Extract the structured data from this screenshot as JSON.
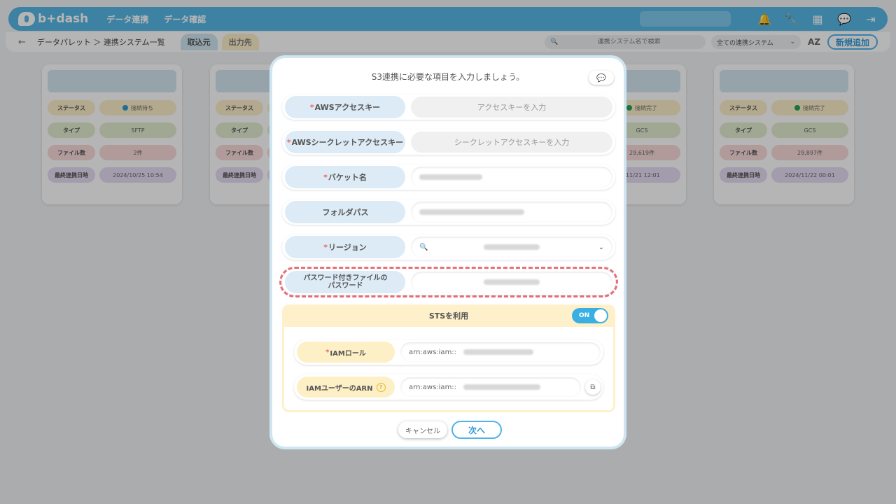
{
  "header": {
    "logo": "b+dash",
    "nav": [
      "データ連携",
      "データ確認"
    ]
  },
  "subbar": {
    "breadcrumb": "データパレット ＞ 連携システム一覧",
    "tab_in": "取込元",
    "tab_out": "出力先",
    "search_placeholder": "連携システム名で検索",
    "filter": "全ての連携システム",
    "sort": "AZ",
    "add": "新規追加"
  },
  "cards": [
    {
      "status_label": "ステータス",
      "status": "接続待ち",
      "type_label": "タイプ",
      "type": "SFTP",
      "files_label": "ファイル数",
      "files": "2件",
      "last_label": "最終連携日時",
      "last": "2024/10/25 10:54"
    },
    {
      "status_label": "ステータス",
      "type_label": "タイプ",
      "files_label": "ファイル数",
      "last_label": "最終連携日時"
    },
    {
      "status": "接続完了",
      "type": "GCS",
      "files": "29,619件",
      "last": "/11/21 12:01"
    },
    {
      "status_label": "ステータス",
      "status": "接続完了",
      "type_label": "タイプ",
      "type": "GCS",
      "files_label": "ファイル数",
      "files": "29,897件",
      "last_label": "最終連携日時",
      "last": "2024/11/22 00:01"
    }
  ],
  "modal": {
    "title": "S3連携に必要な項目を入力しましょう。",
    "fields": [
      {
        "label": "AWSアクセスキー",
        "required": "*",
        "placeholder": "アクセスキーを入力"
      },
      {
        "label": "AWSシークレットアクセスキー",
        "required": "*",
        "placeholder": "シークレットアクセスキーを入力"
      },
      {
        "label": "バケット名",
        "required": "*"
      },
      {
        "label": "フォルダパス",
        "required": ""
      },
      {
        "label": "リージョン",
        "required": "*"
      },
      {
        "label": "パスワード付きファイルの\nパスワード",
        "required": ""
      }
    ],
    "sts": {
      "label": "STSを利用",
      "toggle": "ON"
    },
    "iam_role": {
      "label": "IAMロール",
      "required": "*",
      "prefix": "arn:aws:iam::"
    },
    "iam_user_arn": {
      "label": "IAMユーザーのARN",
      "prefix": "arn:aws:iam::"
    },
    "cancel": "キャンセル",
    "next": "次へ"
  }
}
